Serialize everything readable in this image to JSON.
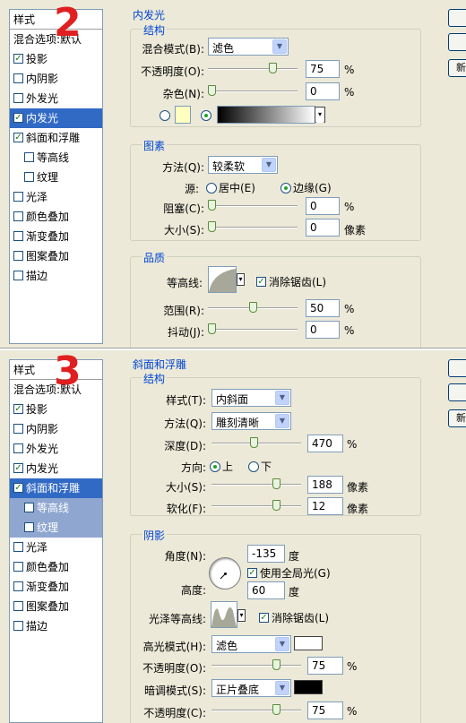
{
  "top": {
    "step_number": "2",
    "sidebar": {
      "header": "样式",
      "items": [
        {
          "label": "混合选项:默认",
          "checkbox": false
        },
        {
          "label": "投影",
          "checkbox": true,
          "checked": true
        },
        {
          "label": "内阴影",
          "checkbox": true,
          "checked": false
        },
        {
          "label": "外发光",
          "checkbox": true,
          "checked": false
        },
        {
          "label": "内发光",
          "checkbox": true,
          "checked": true,
          "selected": true
        },
        {
          "label": "斜面和浮雕",
          "checkbox": true,
          "checked": true
        },
        {
          "label": "等高线",
          "checkbox": true,
          "checked": false,
          "indent": true
        },
        {
          "label": "纹理",
          "checkbox": true,
          "checked": false,
          "indent": true
        },
        {
          "label": "光泽",
          "checkbox": true,
          "checked": false
        },
        {
          "label": "颜色叠加",
          "checkbox": true,
          "checked": false
        },
        {
          "label": "渐变叠加",
          "checkbox": true,
          "checked": false
        },
        {
          "label": "图案叠加",
          "checkbox": true,
          "checked": false
        },
        {
          "label": "描边",
          "checkbox": true,
          "checked": false
        }
      ]
    },
    "panel_title": "内发光",
    "structure": {
      "title": "结构",
      "blend_label": "混合模式(B):",
      "blend_value": "滤色",
      "opacity_label": "不透明度(O):",
      "opacity_value": "75",
      "opacity_unit": "%",
      "opacity_level": 75,
      "noise_label": "杂色(N):",
      "noise_value": "0",
      "noise_unit": "%",
      "noise_level": 0,
      "color_swatch": "#ffffc0"
    },
    "elements": {
      "title": "图素",
      "method_label": "方法(Q):",
      "method_value": "较柔软",
      "source_label": "源:",
      "source_center": "居中(E)",
      "source_edge": "边缘(G)",
      "choke_label": "阻塞(C):",
      "choke_value": "0",
      "choke_unit": "%",
      "size_label": "大小(S):",
      "size_value": "0",
      "size_unit": "像素"
    },
    "quality": {
      "title": "品质",
      "contour_label": "等高线:",
      "antialias_label": "消除锯齿(L)",
      "range_label": "范围(R):",
      "range_value": "50",
      "range_unit": "%",
      "range_level": 50,
      "jitter_label": "抖动(J):",
      "jitter_value": "0",
      "jitter_unit": "%"
    },
    "side_button": "新"
  },
  "bottom": {
    "step_number": "3",
    "sidebar": {
      "header": "样式",
      "items": [
        {
          "label": "混合选项:默认",
          "checkbox": false
        },
        {
          "label": "投影",
          "checkbox": true,
          "checked": true
        },
        {
          "label": "内阴影",
          "checkbox": true,
          "checked": false
        },
        {
          "label": "外发光",
          "checkbox": true,
          "checked": false
        },
        {
          "label": "内发光",
          "checkbox": true,
          "checked": true
        },
        {
          "label": "斜面和浮雕",
          "checkbox": true,
          "checked": true,
          "selected": true
        },
        {
          "label": "等高线",
          "checkbox": true,
          "checked": false,
          "indent": true,
          "sub": true
        },
        {
          "label": "纹理",
          "checkbox": true,
          "checked": false,
          "indent": true,
          "sub": true
        },
        {
          "label": "光泽",
          "checkbox": true,
          "checked": false
        },
        {
          "label": "颜色叠加",
          "checkbox": true,
          "checked": false
        },
        {
          "label": "渐变叠加",
          "checkbox": true,
          "checked": false
        },
        {
          "label": "图案叠加",
          "checkbox": true,
          "checked": false
        },
        {
          "label": "描边",
          "checkbox": true,
          "checked": false
        }
      ]
    },
    "panel_title": "斜面和浮雕",
    "structure": {
      "title": "结构",
      "style_label": "样式(T):",
      "style_value": "内斜面",
      "technique_label": "方法(Q):",
      "technique_value": "雕刻清晰",
      "depth_label": "深度(D):",
      "depth_value": "470",
      "depth_unit": "%",
      "direction_label": "方向:",
      "direction_up": "上",
      "direction_down": "下",
      "size_label": "大小(S):",
      "size_value": "188",
      "size_unit": "像素",
      "soften_label": "软化(F):",
      "soften_value": "12",
      "soften_unit": "像素"
    },
    "shading": {
      "title": "阴影",
      "angle_label": "角度(N):",
      "angle_value": "-135",
      "angle_unit": "度",
      "global_light_label": "使用全局光(G)",
      "altitude_label": "高度:",
      "altitude_value": "60",
      "altitude_unit": "度",
      "gloss_label": "光泽等高线:",
      "antialias_label": "消除锯齿(L)",
      "highlight_label": "高光模式(H):",
      "highlight_value": "滤色",
      "highlight_color": "#ffffff",
      "hl_opacity_label": "不透明度(O):",
      "hl_opacity_value": "75",
      "hl_opacity_unit": "%",
      "shadow_label": "暗调模式(S):",
      "shadow_value": "正片叠底",
      "shadow_color": "#000000",
      "sh_opacity_label": "不透明度(C):",
      "sh_opacity_value": "75",
      "sh_opacity_unit": "%"
    },
    "side_button": "新"
  }
}
